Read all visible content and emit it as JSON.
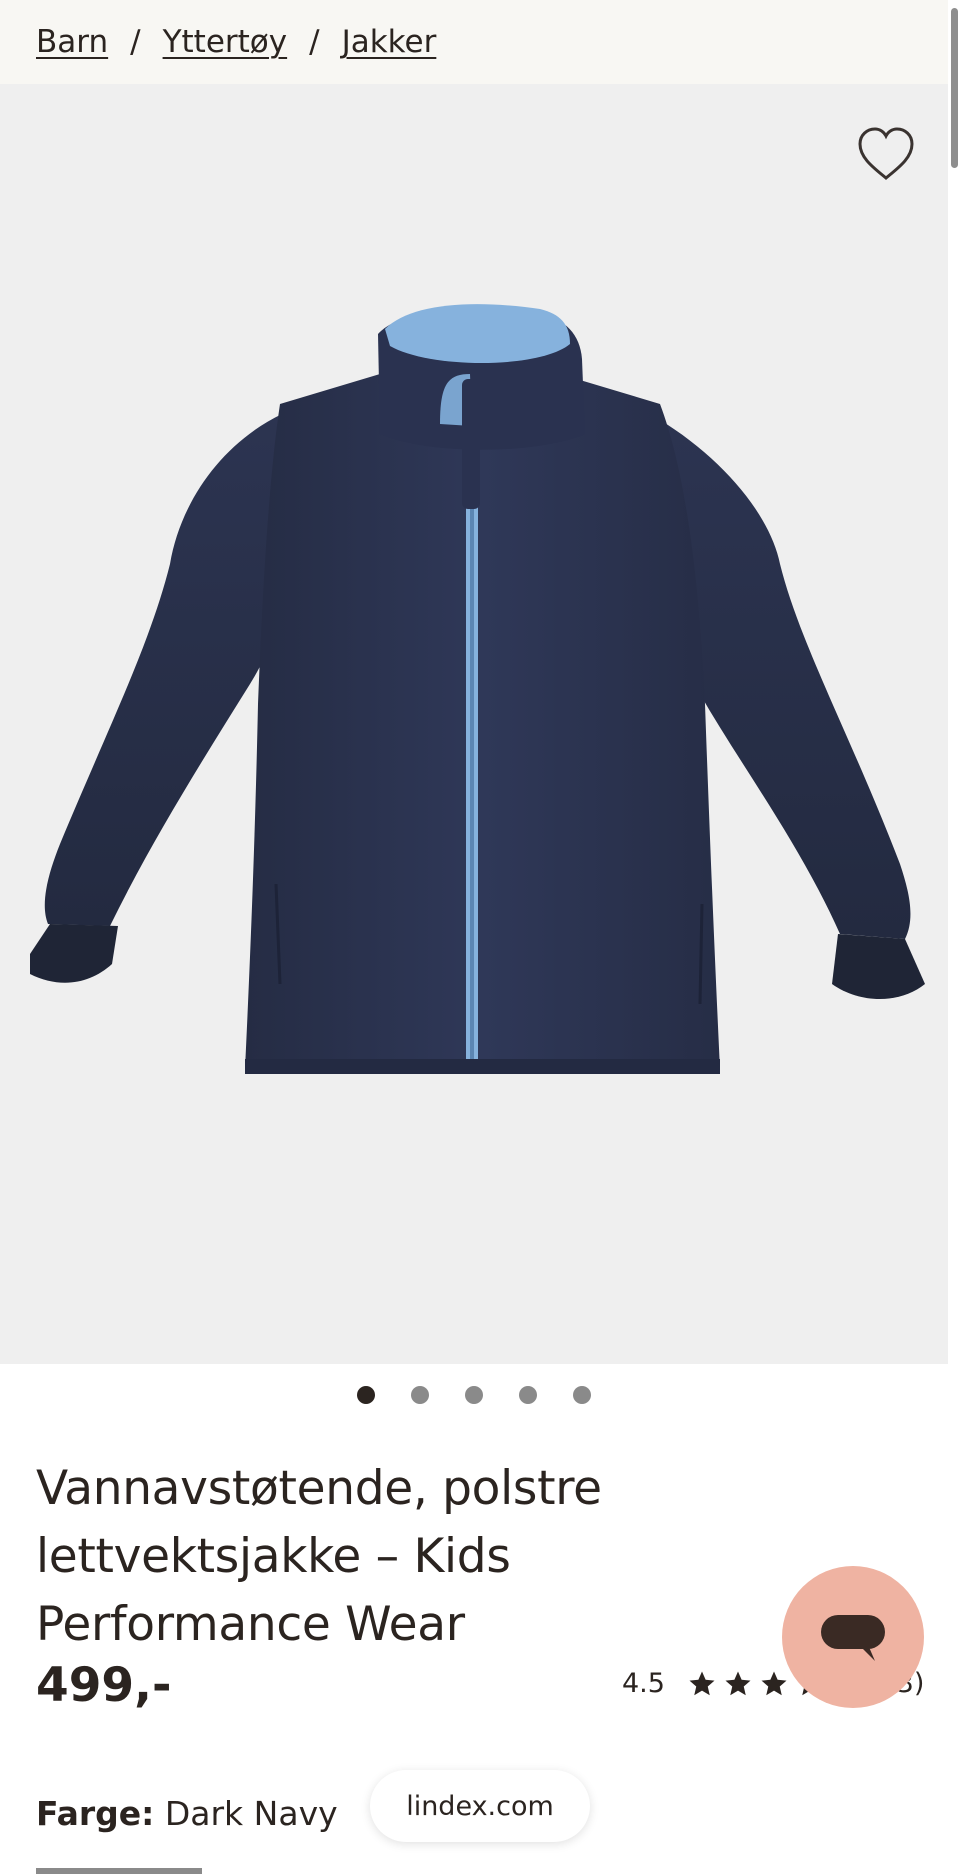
{
  "breadcrumb": {
    "items": [
      {
        "label": "Barn"
      },
      {
        "label": "Yttertøy"
      },
      {
        "label": "Jakker"
      }
    ],
    "separator": "/"
  },
  "gallery": {
    "image_alt": "Dark navy padded jacket with light blue collar",
    "active_index": 0,
    "dot_count": 5
  },
  "product": {
    "title_lines": [
      "Vannavstøtende, polstre",
      "lettvektsjakke – Kids",
      "Performance Wear"
    ],
    "price": "499,-",
    "rating_value": "4.5",
    "rating_count": "(13)",
    "color_label": "Farge:",
    "color_value": "Dark Navy"
  },
  "site_pill": "lindex.com",
  "colors": {
    "breadcrumb_bg": "#f8f7f3",
    "gallery_bg": "#efefef",
    "text": "#2b2420",
    "chat_bubble": "#efb3a2",
    "jacket_navy": "#2c3551",
    "collar_blue": "#86b2dd"
  }
}
